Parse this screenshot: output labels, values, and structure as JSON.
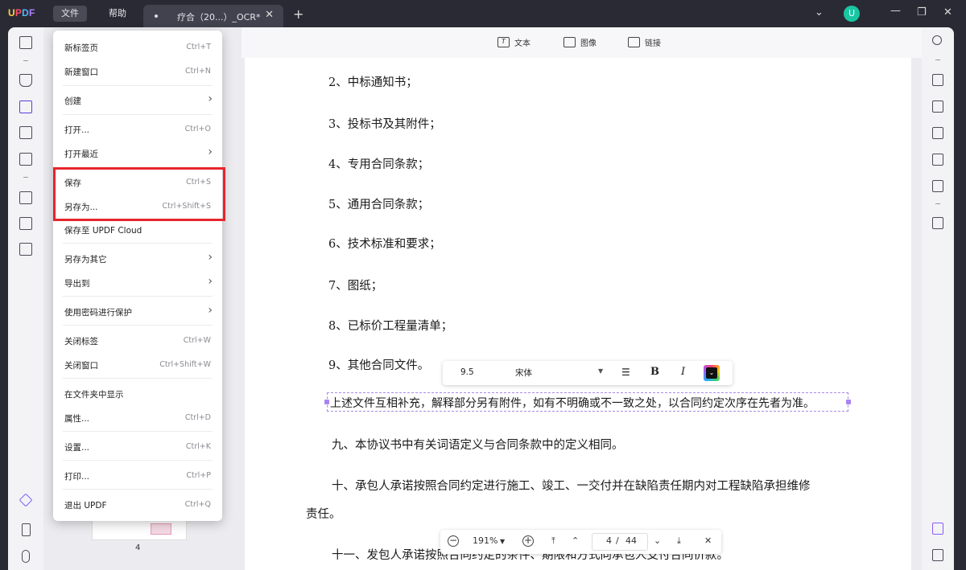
{
  "app": {
    "logo": "UPDF",
    "menus": [
      "文件",
      "帮助"
    ],
    "tab_title": "疗合（20...）_OCR*",
    "avatar_letter": "U"
  },
  "toolbar": {
    "text_label": "文本",
    "image_label": "图像",
    "link_label": "链接"
  },
  "file_menu": [
    {
      "label": "新标签页",
      "shortcut": "Ctrl+T"
    },
    {
      "label": "新建窗口",
      "shortcut": "Ctrl+N"
    },
    {
      "label": "创建",
      "submenu": true
    },
    {
      "label": "打开...",
      "shortcut": "Ctrl+O"
    },
    {
      "label": "打开最近",
      "submenu": true
    },
    {
      "label": "保存",
      "shortcut": "Ctrl+S"
    },
    {
      "label": "另存为...",
      "shortcut": "Ctrl+Shift+S"
    },
    {
      "label": "保存至 UPDF Cloud"
    },
    {
      "label": "另存为其它",
      "submenu": true
    },
    {
      "label": "导出到",
      "submenu": true
    },
    {
      "label": "使用密码进行保护",
      "submenu": true
    },
    {
      "label": "关闭标签",
      "shortcut": "Ctrl+W"
    },
    {
      "label": "关闭窗口",
      "shortcut": "Ctrl+Shift+W"
    },
    {
      "label": "在文件夹中显示"
    },
    {
      "label": "属性...",
      "shortcut": "Ctrl+D"
    },
    {
      "label": "设置...",
      "shortcut": "Ctrl+K"
    },
    {
      "label": "打印...",
      "shortcut": "Ctrl+P"
    },
    {
      "label": "退出 UPDF",
      "shortcut": "Ctrl+Q"
    }
  ],
  "document": {
    "lines": [
      "2、中标通知书；",
      "3、投标书及其附件；",
      "4、专用合同条款；",
      "5、通用合同条款；",
      "6、技术标准和要求；",
      "7、图纸；",
      "8、已标价工程量清单；",
      "9、其他合同文件。",
      "上述文件互相补充，解释部分另有附件，如有不明确或不一致之处，以合同约定次序在先者为准。",
      "九、本协议书中有关词语定义与合同条款中的定义相同。",
      "十、承包人承诺按照合同约定进行施工、竣工、一交付并在缺陷责任期内对工程缺陷承担维修",
      "责任。",
      "十一、发包人承诺按照合同约定的条件、期限和方式向承包人支付合同价款。"
    ]
  },
  "format_bar": {
    "font_size": "9.5",
    "font_name": "宋体",
    "bold_label": "B",
    "italic_label": "I"
  },
  "page_nav": {
    "zoom": "191%",
    "current_page": "4",
    "separator": "/",
    "total_pages": "44"
  },
  "thumbnail": {
    "page_number": "4"
  }
}
